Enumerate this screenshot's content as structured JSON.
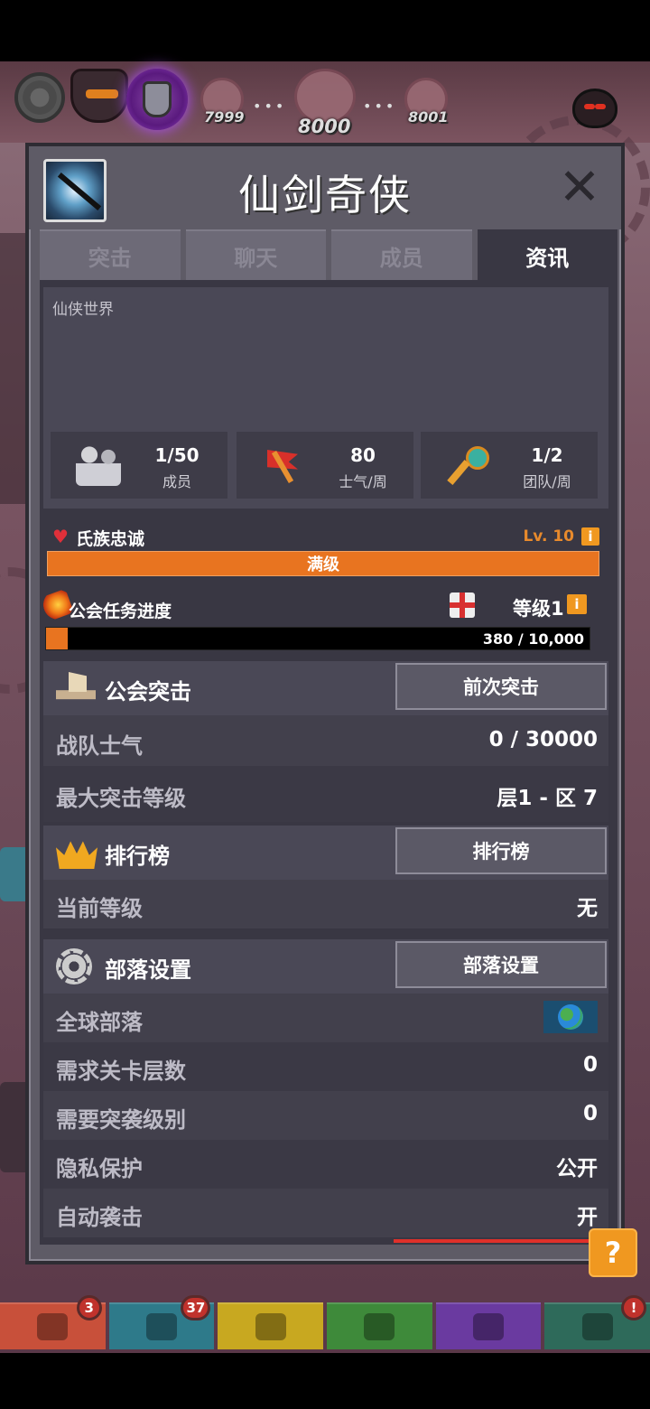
{
  "hud": {
    "level_left": "7999",
    "level_center": "8000",
    "level_right": "8001",
    "dots": "•••"
  },
  "modal": {
    "title": "仙剑奇侠",
    "close_symbol": "✕",
    "tabs": [
      {
        "label": "突击",
        "active": false
      },
      {
        "label": "聊天",
        "active": false
      },
      {
        "label": "成员",
        "active": false
      },
      {
        "label": "资讯",
        "active": true
      }
    ]
  },
  "info": {
    "description": "仙侠世界",
    "stats": [
      {
        "value": "1/50",
        "label": "成员",
        "icon": "people-icon"
      },
      {
        "value": "80",
        "label": "士气/周",
        "icon": "flag-icon"
      },
      {
        "value": "1/2",
        "label": "团队/周",
        "icon": "key-icon"
      }
    ]
  },
  "loyalty": {
    "label": "氏族忠诚",
    "level": "Lv. 10",
    "info_symbol": "i",
    "bar_text": "满级",
    "progress": 1.0
  },
  "guild_task": {
    "label": "公会任务进度",
    "grade": "等级1",
    "info_symbol": "i",
    "current": 380,
    "max": 10000,
    "bar_text": "380 / 10,000"
  },
  "raid": {
    "title": "公会突击",
    "button": "前次突击",
    "rows": [
      {
        "label": "战队士气",
        "value": "0 / 30000"
      },
      {
        "label": "最大突击等级",
        "value": "层1 - 区 7"
      }
    ]
  },
  "leaderboard": {
    "title": "排行榜",
    "button": "排行榜",
    "rows": [
      {
        "label": "当前等级",
        "value": "无"
      }
    ]
  },
  "tribe": {
    "title": "部落设置",
    "button": "部落设置",
    "rows": [
      {
        "label": "全球部落",
        "value": "",
        "icon": "globe-icon"
      },
      {
        "label": "需求关卡层数",
        "value": "0"
      },
      {
        "label": "需要突袭级别",
        "value": "0"
      },
      {
        "label": "隐私保护",
        "value": "公开"
      },
      {
        "label": "自动袭击",
        "value": "开"
      }
    ]
  },
  "help_button": "?",
  "bottom_tabs": [
    {
      "name": "sword",
      "color": "#c8503a",
      "badge": "3"
    },
    {
      "name": "helmet",
      "color": "#2e7a8a",
      "badge": "37"
    },
    {
      "name": "armor",
      "color": "#c8a820",
      "badge": ""
    },
    {
      "name": "pet",
      "color": "#3e8a3a",
      "badge": ""
    },
    {
      "name": "heart",
      "color": "#6a3aa0",
      "badge": ""
    },
    {
      "name": "scroll",
      "color": "#2e6a5a",
      "badge": "!"
    }
  ]
}
